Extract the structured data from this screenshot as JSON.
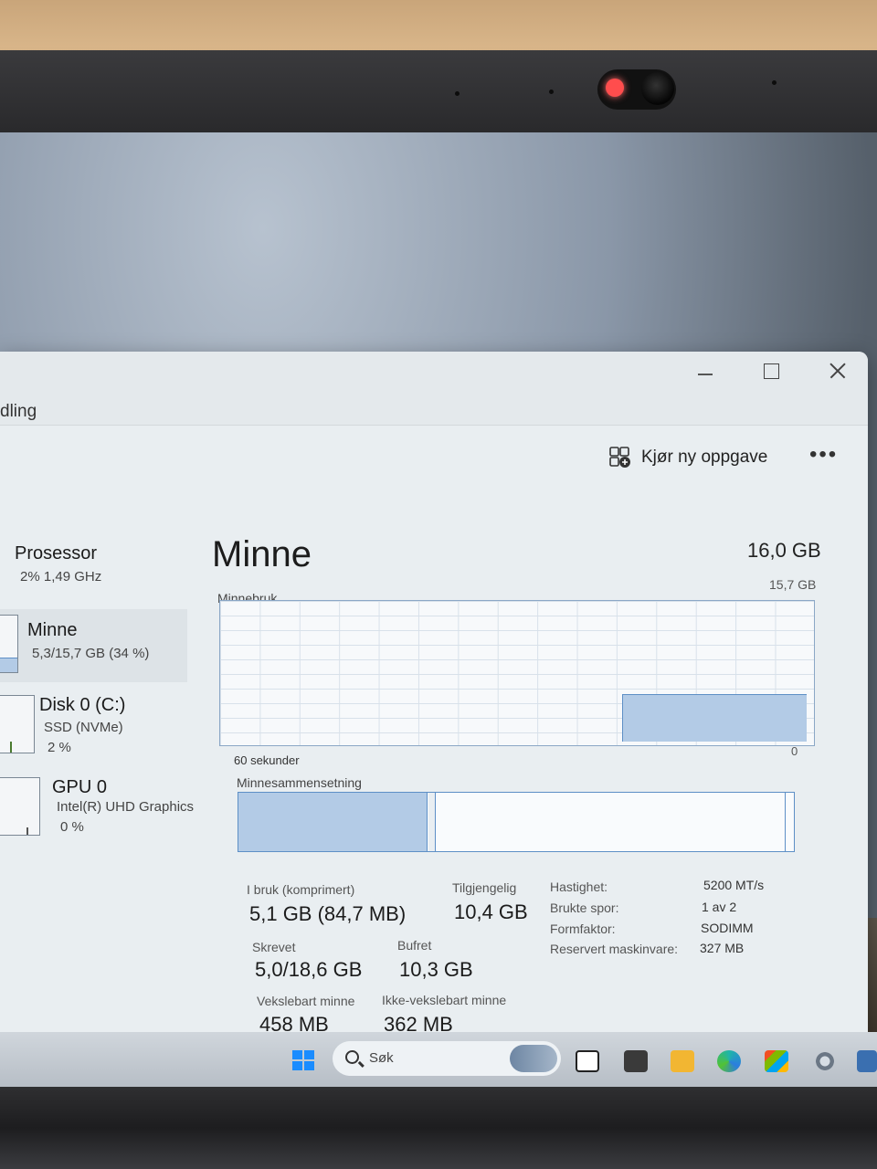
{
  "window": {
    "title_partial": "dling",
    "buttons": {
      "minimize": "minimize",
      "maximize": "maximize",
      "close": "close"
    }
  },
  "toolbar": {
    "run_task_label": "Kjør ny oppgave",
    "more_label": "•••"
  },
  "sidebar": {
    "items": [
      {
        "name": "Prosessor",
        "sub": "2%  1,49 GHz"
      },
      {
        "name": "Minne",
        "sub": "5,3/15,7 GB (34 %)",
        "selected": true
      },
      {
        "name": "Disk 0 (C:)",
        "sub": "SSD (NVMe)",
        "sub2": "2 %"
      },
      {
        "name": "GPU 0",
        "sub": "Intel(R) UHD Graphics",
        "sub2": "0 %"
      }
    ]
  },
  "main": {
    "title": "Minne",
    "total": "16,0 GB",
    "usage_label": "Minnebruk",
    "usage_max": "15,7 GB",
    "time_label": "60 sekunder",
    "zero_label": "0",
    "composition_label": "Minnesammensetning",
    "usage_fraction": 0.34,
    "stats": {
      "in_use_label": "I bruk (komprimert)",
      "in_use_value": "5,1 GB (84,7 MB)",
      "available_label": "Tilgjengelig",
      "available_value": "10,4 GB",
      "committed_label": "Skrevet",
      "committed_value": "5,0/18,6 GB",
      "cached_label": "Bufret",
      "cached_value": "10,3 GB",
      "paged_label": "Vekslebart minne",
      "paged_value": "458 MB",
      "nonpaged_label": "Ikke-vekslebart minne",
      "nonpaged_value": "362 MB"
    },
    "details": [
      {
        "label": "Hastighet:",
        "value": "5200 MT/s"
      },
      {
        "label": "Brukte spor:",
        "value": "1 av 2"
      },
      {
        "label": "Formfaktor:",
        "value": "SODIMM"
      },
      {
        "label": "Reservert maskinvare:",
        "value": "327 MB"
      }
    ]
  },
  "taskbar": {
    "search_placeholder": "Søk"
  },
  "colors": {
    "accent": "#5d8fc6",
    "fill": "#b3cbe6",
    "window_bg": "#e9eef1"
  }
}
